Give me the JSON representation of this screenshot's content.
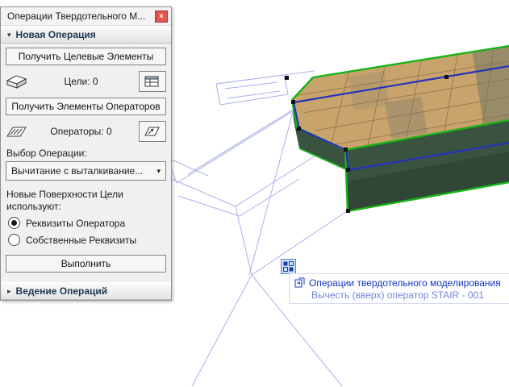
{
  "colors": {
    "green": "#17b317",
    "blue": "#2233bb",
    "wireframe": "#aab0e8",
    "wood": "#c9a36c",
    "wood_line": "#8f7148",
    "face_dark": "#3a5340",
    "close_red": "#e0544a",
    "tooltip_title": "#1434c8",
    "tooltip_sub": "#7486d8"
  },
  "panel": {
    "title": "Операции Твердотельного М...",
    "close_glyph": "✕",
    "new_operation": {
      "header": "Новая Операция",
      "collapse_glyph": "▾",
      "get_targets_button": "Получить Целевые Элементы",
      "targets_label": "Цели: 0",
      "get_operators_button": "Получить Элементы Операторов",
      "operators_label": "Операторы: 0",
      "choose_operation_label": "Выбор Операции:",
      "operation_value": "Вычитание с выталкивание...",
      "dropdown_glyph": "▾",
      "surfaces_line1": "Новые Поверхности Цели",
      "surfaces_line2": "используют:",
      "radio_operator": "Реквизиты Оператора",
      "radio_own": "Собственные Реквизиты",
      "execute_button": "Выполнить"
    },
    "manage_operations": {
      "header": "Ведение Операций",
      "collapse_glyph": "▸"
    }
  },
  "tooltip": {
    "title": "Операции твердотельного моделирования",
    "subtitle": "Вычесть (вверх) оператор STAIR - 001"
  }
}
